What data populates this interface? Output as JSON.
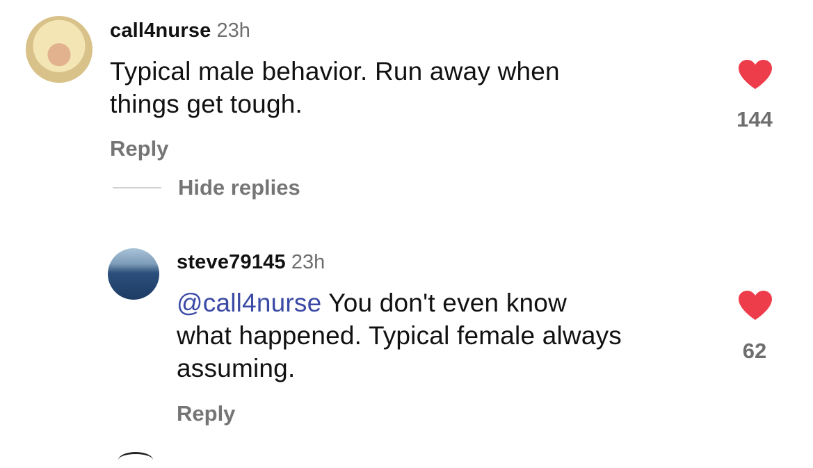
{
  "comments": [
    {
      "username": "call4nurse",
      "time": "23h",
      "text_line1": "Typical male behavior. Run away when",
      "text_line2": "things get tough.",
      "reply_label": "Reply",
      "like_count": "144",
      "icons": {
        "avatar": "user-avatar-photo",
        "like": "heart-icon"
      }
    }
  ],
  "thread": {
    "hide_replies_label": "Hide replies"
  },
  "replies": [
    {
      "username": "steve79145",
      "time": "23h",
      "mention": "@call4nurse",
      "text_line1_rest": " You don't even know",
      "text_line2": "what happened. Typical female always",
      "text_line3": "assuming.",
      "reply_label": "Reply",
      "like_count": "62",
      "icons": {
        "avatar": "user-avatar-photo",
        "like": "heart-icon"
      }
    }
  ],
  "colors": {
    "heart": "#ed3d4a",
    "mention": "#3b4aa5",
    "muted": "#757575"
  }
}
